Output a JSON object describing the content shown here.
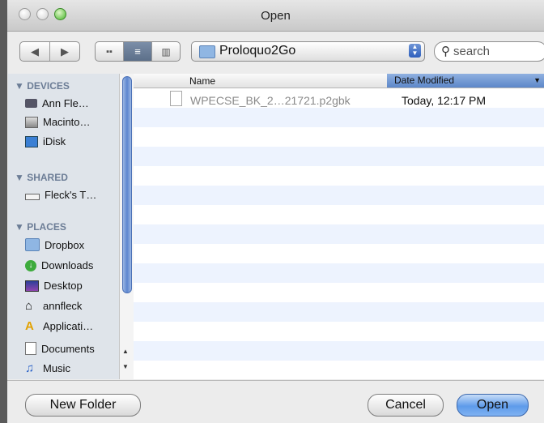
{
  "window": {
    "title": "Open"
  },
  "toolbar": {
    "location": "Proloquo2Go",
    "search_placeholder": "search"
  },
  "sidebar": {
    "devices_header": "DEVICES",
    "devices": [
      {
        "label": "Ann Fle…",
        "icon": "laptop-icon"
      },
      {
        "label": "Macinto…",
        "icon": "hard-drive-icon"
      },
      {
        "label": "iDisk",
        "icon": "idisk-icon"
      }
    ],
    "shared_header": "SHARED",
    "shared": [
      {
        "label": "Fleck's T…",
        "icon": "network-computer-icon"
      }
    ],
    "places_header": "PLACES",
    "places": [
      {
        "label": "Dropbox",
        "icon": "folder-icon"
      },
      {
        "label": "Downloads",
        "icon": "downloads-icon"
      },
      {
        "label": "Desktop",
        "icon": "desktop-icon"
      },
      {
        "label": "annfleck",
        "icon": "home-icon"
      },
      {
        "label": "Applicati…",
        "icon": "applications-icon"
      },
      {
        "label": "Documents",
        "icon": "documents-icon"
      },
      {
        "label": "Music",
        "icon": "music-icon"
      }
    ]
  },
  "file_list": {
    "columns": {
      "name": "Name",
      "date": "Date Modified"
    },
    "files": [
      {
        "name": "WPECSE_BK_2…21721.p2gbk",
        "date": "Today, 12:17 PM"
      }
    ]
  },
  "buttons": {
    "new_folder": "New Folder",
    "cancel": "Cancel",
    "open": "Open"
  }
}
